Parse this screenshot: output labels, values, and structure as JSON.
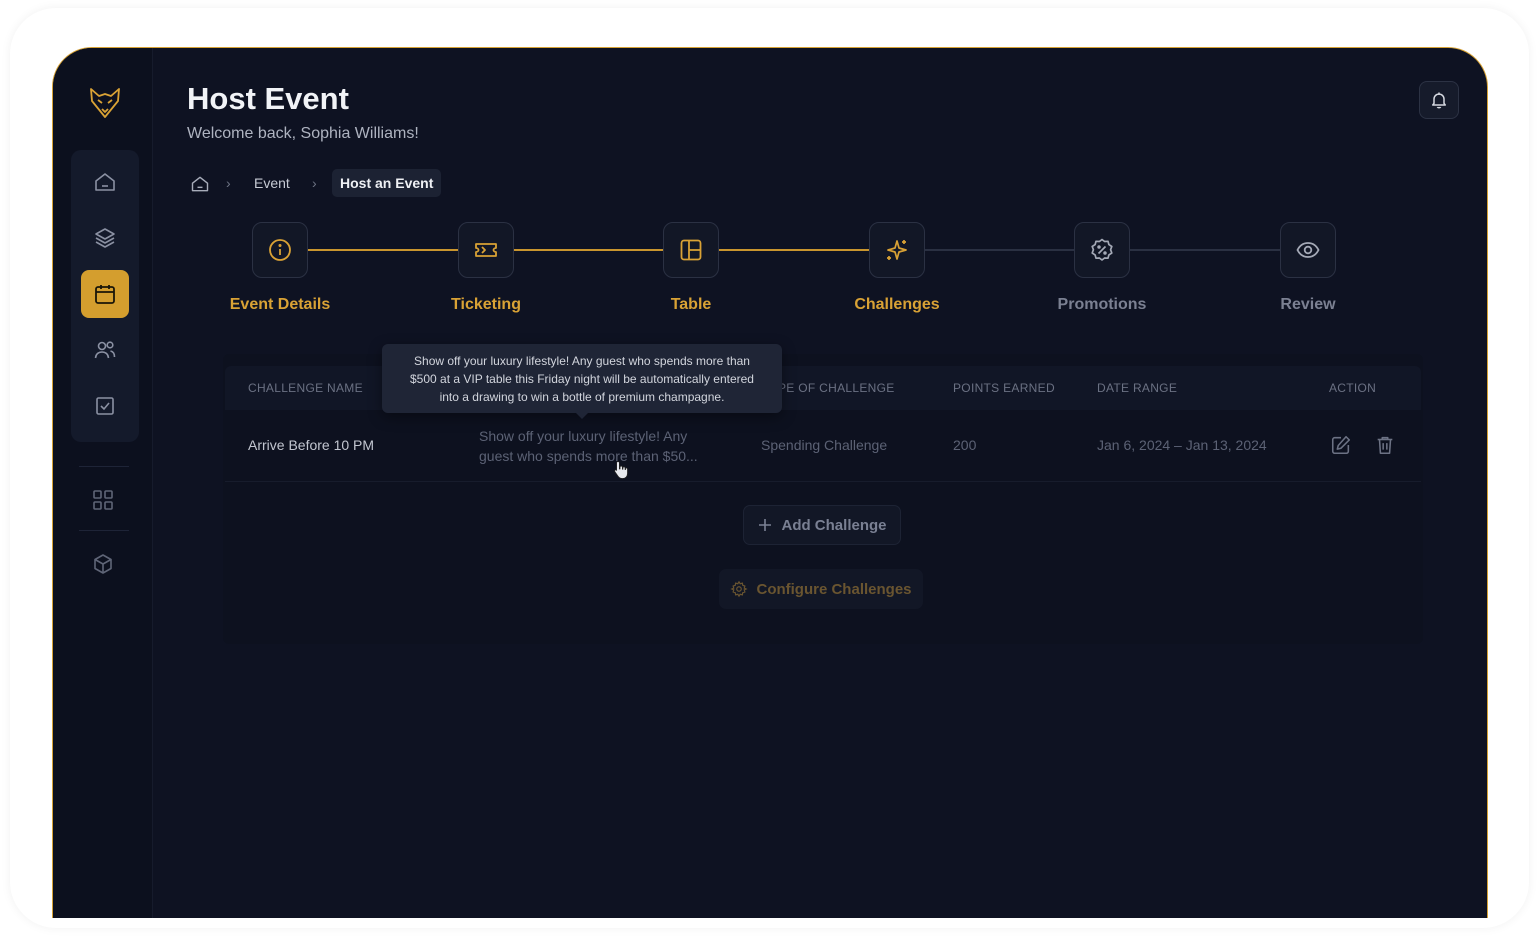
{
  "header": {
    "title": "Host Event",
    "subtitle": "Welcome back, Sophia Williams!"
  },
  "breadcrumb": {
    "event": "Event",
    "current": "Host an Event"
  },
  "steps": [
    {
      "label": "Event Details",
      "icon": "info-icon",
      "state": "complete"
    },
    {
      "label": "Ticketing",
      "icon": "ticket-icon",
      "state": "complete"
    },
    {
      "label": "Table",
      "icon": "table-layout-icon",
      "state": "complete"
    },
    {
      "label": "Challenges",
      "icon": "sparkles-icon",
      "state": "active"
    },
    {
      "label": "Promotions",
      "icon": "discount-badge-icon",
      "state": "pending"
    },
    {
      "label": "Review",
      "icon": "eye-icon",
      "state": "pending"
    }
  ],
  "table": {
    "columns": {
      "name": "CHALLENGE NAME",
      "type": "PE OF CHALLENGE",
      "points": "POINTS EARNED",
      "date": "DATE RANGE",
      "action": "ACTION"
    },
    "rows": [
      {
        "name": "Arrive Before 10 PM",
        "description_line1": "Show off your luxury lifestyle! Any",
        "description_line2": "guest who spends more than $50...",
        "type": "Spending Challenge",
        "points": "200",
        "date_range": "Jan 6, 2024 – Jan 13, 2024"
      }
    ]
  },
  "tooltip": {
    "line1": "Show off your luxury lifestyle! Any guest who spends more than",
    "line2": "$500 at a VIP table this Friday night will be automatically entered",
    "line3": "into a drawing to win a bottle of premium champagne."
  },
  "buttons": {
    "add_challenge": "Add Challenge",
    "configure_challenges": "Configure Challenges"
  },
  "colors": {
    "accent": "#d9a235",
    "background": "#0e1222",
    "frame_border": "#d6a133"
  }
}
